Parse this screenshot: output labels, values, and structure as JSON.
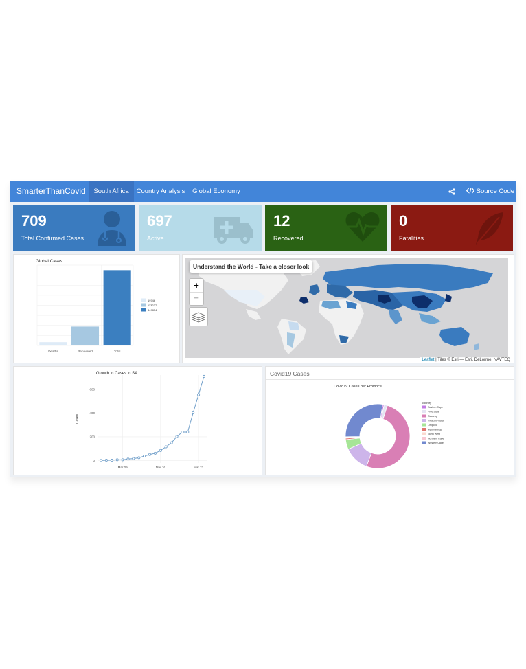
{
  "navbar": {
    "brand": "SmarterThanCovid",
    "tabs": [
      {
        "label": "South Africa",
        "active": true
      },
      {
        "label": "Country Analysis",
        "active": false
      },
      {
        "label": "Global Economy",
        "active": false
      }
    ],
    "share_icon": "share-icon",
    "source_code_label": "Source Code",
    "source_code_icon": "code-icon"
  },
  "value_boxes": [
    {
      "value": "709",
      "label": "Total Confirmed Cases",
      "color": "#3a7bbf",
      "icon": "doctor-icon"
    },
    {
      "value": "697",
      "label": "Active",
      "color": "#b6dbe9",
      "icon": "ambulance-icon"
    },
    {
      "value": "12",
      "label": "Recovered",
      "color": "#2a6214",
      "icon": "heartbeat-icon"
    },
    {
      "value": "0",
      "label": "Fatalities",
      "color": "#8b1a12",
      "icon": "feather-icon"
    }
  ],
  "map": {
    "title": "Understand the World - Take a closer look",
    "zoom_in": "+",
    "zoom_out": "−",
    "layers_icon": "layers-icon",
    "attribution_link": "Leaflet",
    "attribution_text": " | Tiles © Esri — Esri, DeLorme, NAVTEQ"
  },
  "province_panel": {
    "header": "Covid19 Cases"
  },
  "chart_data": [
    {
      "type": "bar",
      "title": "Global Cases",
      "categories": [
        "Deaths",
        "Recovered",
        "Total"
      ],
      "values": [
        19746,
        113237,
        449854
      ],
      "colors": [
        "#deebf7",
        "#a6c8e1",
        "#3b7fc0"
      ],
      "legend": [
        "19746",
        "113237",
        "449854"
      ],
      "legend_position": "right",
      "ylim": [
        0,
        480000
      ],
      "grid": true
    },
    {
      "type": "line",
      "title": "Growth in Cases in SA",
      "xlabel": "",
      "ylabel": "Cases",
      "x_ticks": [
        "Mar 09",
        "Mar 16",
        "Mar 23"
      ],
      "y_ticks": [
        "0",
        "200",
        "400",
        "600"
      ],
      "ylim": [
        -20,
        720
      ],
      "values": [
        1,
        3,
        3,
        7,
        7,
        13,
        17,
        24,
        38,
        51,
        62,
        85,
        116,
        150,
        202,
        240,
        240,
        402,
        554,
        709
      ],
      "color": "#6f9ec9",
      "grid": true
    },
    {
      "type": "pie",
      "title": "Covid19 Cases per Province",
      "donut": true,
      "legend_title": "country",
      "legend_position": "right",
      "categories": [
        "Eastern Cape",
        "Free State",
        "Gauteng",
        "KwaZulu-Natal",
        "Limpopo",
        "Mpumalanga",
        "North West",
        "Northern Cape",
        "Western Cape"
      ],
      "values": [
        5,
        12,
        360,
        90,
        35,
        5,
        3,
        2,
        197
      ],
      "colors": [
        "#c27be3",
        "#e4e4f2",
        "#d97fb5",
        "#cdb5ea",
        "#a6e597",
        "#e0756f",
        "#fad9cf",
        "#f8c8d3",
        "#7189cf"
      ]
    }
  ]
}
